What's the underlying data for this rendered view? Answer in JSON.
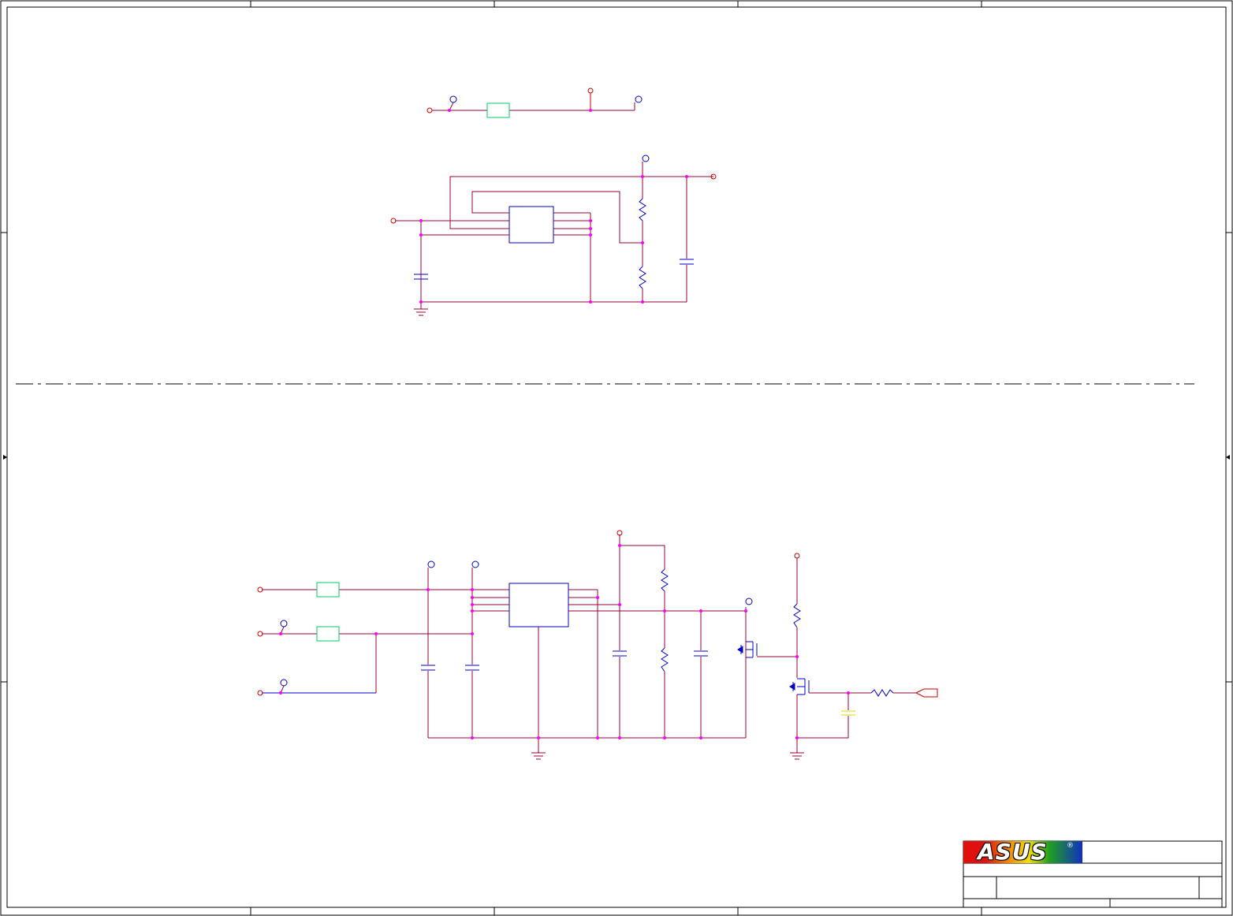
{
  "title_block": {
    "brand": "ASUS",
    "registered_mark": "®"
  },
  "colors": {
    "border": "#000000",
    "wire_red": "#cc0000",
    "wire_blue": "#0000cc",
    "wire_maroon": "#990033",
    "net_purple": "#990066",
    "junction": "#ff00ff",
    "ferrite": "#00cc66",
    "capacitor_yellow": "#e6d800",
    "section_divider": "#000000"
  },
  "icons": {
    "power_port": "open-circle",
    "ground": "ground-symbol",
    "resistor": "zigzag",
    "capacitor": "parallel-plates",
    "mosfet": "n-channel-mosfet",
    "connector": "arrow-connector"
  }
}
